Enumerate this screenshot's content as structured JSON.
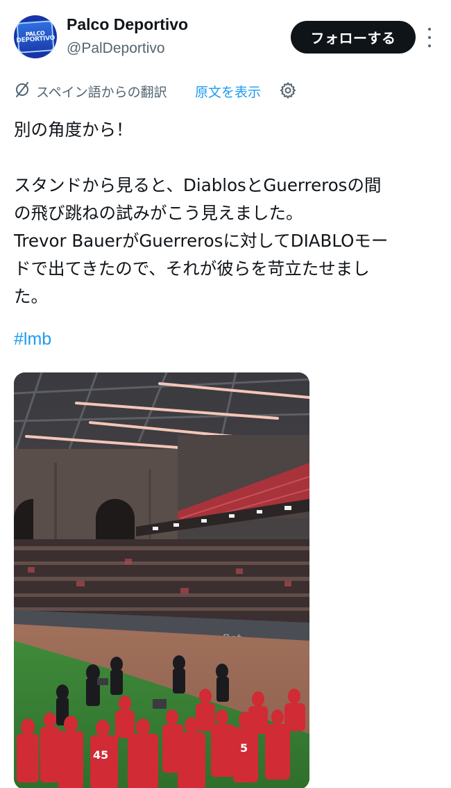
{
  "account": {
    "display_name": "Palco Deportivo",
    "handle": "@PalDeportivo",
    "avatar_line1": "PALCO",
    "avatar_line2": "DEPORTIVO"
  },
  "follow_button_label": "フォローする",
  "translation": {
    "label": "スペイン語からの翻訳",
    "show_original": "原文を表示"
  },
  "post": {
    "lines": [
      "別の角度から！",
      "",
      "スタンドから見ると、DiablosとGuerrerosの間",
      "の飛び跳ねの試みがこう見えました。",
      "Trevor BauerがGuerrerosに対してDIABLOモー",
      "ドで出てきたので、それが彼らを苛立たせまし",
      "た。"
    ],
    "hashtag": "#lmb"
  },
  "media": {
    "signage": "Bet",
    "jersey_numbers": [
      "45",
      "5"
    ]
  },
  "colors": {
    "link": "#1d9bf0",
    "text": "#0f1419",
    "secondary": "#536471",
    "button_bg": "#0f1419"
  },
  "icons": {
    "translate": "translate-icon",
    "settings": "gear-icon",
    "more": "more-vertical-icon"
  }
}
